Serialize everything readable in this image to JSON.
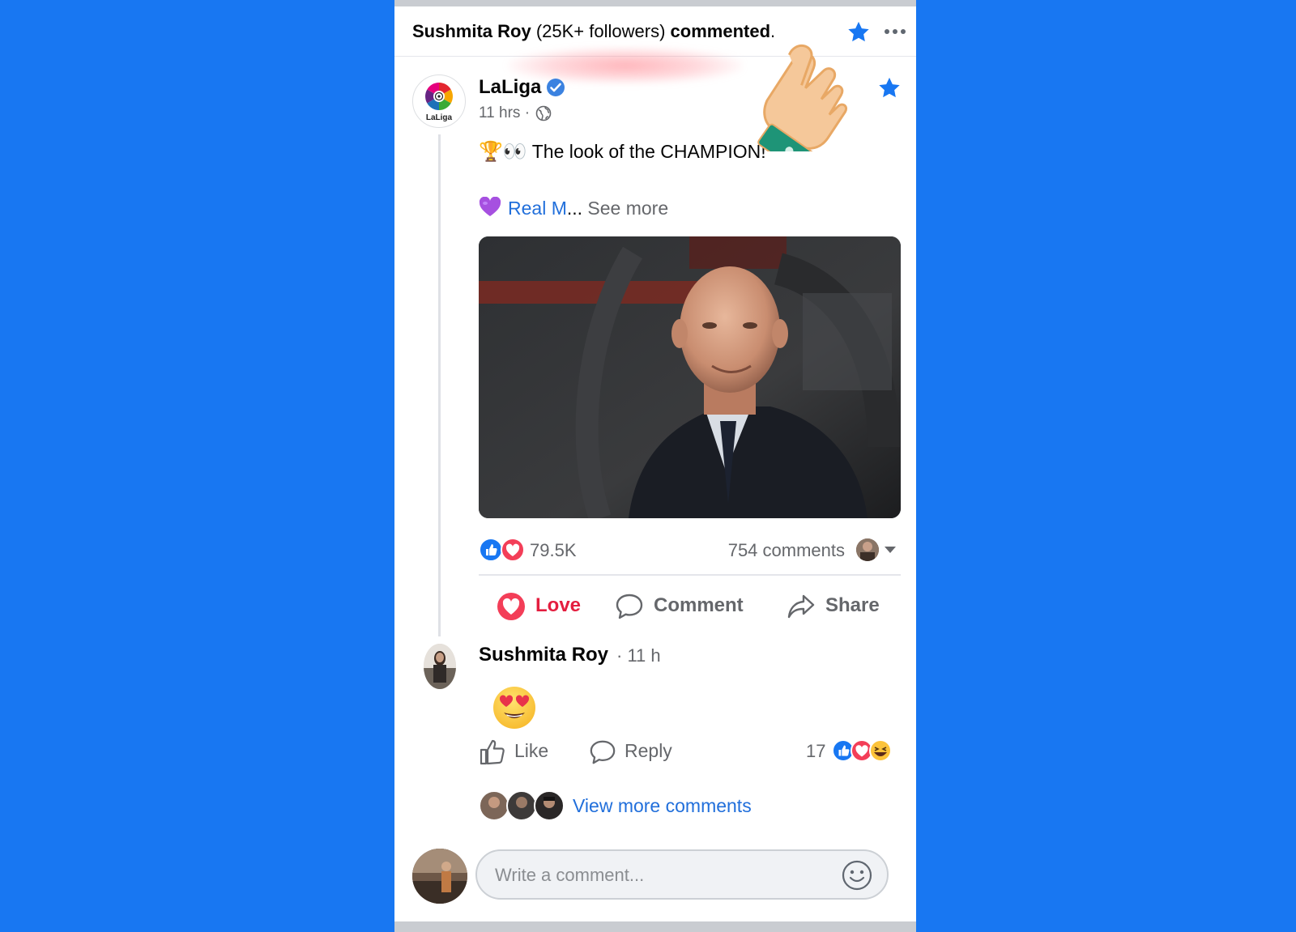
{
  "notification": {
    "user": "Sushmita Roy",
    "followers": "(25K+ followers)",
    "action": "commented",
    "period": "."
  },
  "post": {
    "page_name": "LaLiga",
    "logo_text": "LaLiga",
    "time": "11 hrs",
    "separator": "·",
    "emoji_prefix": "🏆👀",
    "text": "The look of the CHAMPION!",
    "link_text": "Real M",
    "ellipsis": "...",
    "see_more": "See more",
    "reaction_count": "79.5K",
    "comments_count": "754 comments"
  },
  "actions": {
    "love": "Love",
    "comment": "Comment",
    "share": "Share"
  },
  "comment": {
    "author": "Sushmita Roy",
    "time": "· 11 h",
    "content_emoji": "heart-eyes",
    "like": "Like",
    "reply": "Reply",
    "reaction_count": "17"
  },
  "view_more_comments": "View more comments",
  "composer": {
    "placeholder": "Write a comment..."
  },
  "colors": {
    "background": "#1877f2",
    "link": "#216fdb",
    "love": "#e41e3f",
    "secondary_text": "#65676b"
  },
  "icons": [
    "star-icon",
    "more-options-icon",
    "verified-badge-icon",
    "globe-icon",
    "purple-heart-icon",
    "like-reaction-icon",
    "love-reaction-icon",
    "haha-reaction-icon",
    "love-filled-icon",
    "comment-bubble-icon",
    "share-arrow-icon",
    "thumbs-up-icon",
    "reply-bubble-icon",
    "smiley-icon",
    "pointing-hand-icon"
  ]
}
